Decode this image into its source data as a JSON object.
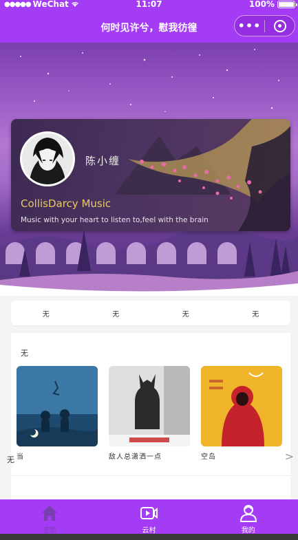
{
  "status_bar": {
    "carrier": "WeChat",
    "time": "11:07",
    "battery": "100%"
  },
  "nav": {
    "title": "何时见许兮，慰我彷徨",
    "more_icon": "more-dots-icon",
    "close_icon": "target-icon"
  },
  "profile": {
    "username": "陈小缠",
    "brand": "CollisDarcy Music",
    "tagline": "Music with your heart to listen to,feel with the brain"
  },
  "quick_tabs": [
    "无",
    "无",
    "无",
    "无"
  ],
  "section": {
    "title": "无",
    "albums": [
      {
        "name": "当",
        "cover_colors": [
          "#2a5a86",
          "#3f78a3"
        ]
      },
      {
        "name": "敌人总潇洒一点",
        "cover_colors": [
          "#dcdcdc",
          "#2a2a2a"
        ]
      },
      {
        "name": "空岛",
        "cover_colors": [
          "#f0b329",
          "#c0222a"
        ]
      }
    ]
  },
  "section2": {
    "title": "无",
    "more": ">"
  },
  "tabbar": {
    "items": [
      {
        "label": "主页",
        "icon": "home-icon",
        "active": true
      },
      {
        "label": "云村",
        "icon": "video-icon",
        "active": false
      },
      {
        "label": "我的",
        "icon": "user-icon",
        "active": false
      }
    ],
    "active_color": "#7a3fae",
    "bar_color": "#a53cf5"
  }
}
